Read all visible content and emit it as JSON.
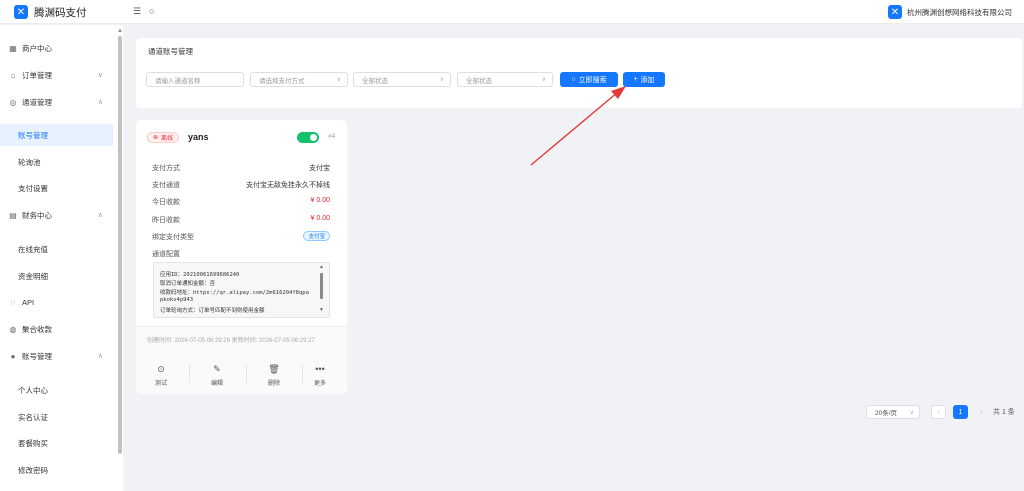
{
  "header": {
    "app_name": "腾渊码支付",
    "company_name": "杭州腾渊创想网络科技有限公司"
  },
  "sidebar": {
    "items": [
      {
        "label": "商户中心",
        "icon": "grid-icon"
      },
      {
        "label": "订单管理",
        "icon": "bag-icon",
        "chevron": "∨"
      },
      {
        "label": "通道管理",
        "icon": "channel-icon",
        "chevron": "∧"
      },
      {
        "label": "账号管理",
        "active": true
      },
      {
        "label": "轮询池"
      },
      {
        "label": "支付设置"
      },
      {
        "label": "财务中心",
        "icon": "finance-icon",
        "chevron": "∧"
      },
      {
        "label": "在线充值"
      },
      {
        "label": "资金明细"
      },
      {
        "label": "API",
        "icon": "api-icon"
      },
      {
        "label": "聚合收款",
        "icon": "aggregate-icon"
      },
      {
        "label": "账号管理",
        "icon": "user-icon",
        "chevron": "∧"
      },
      {
        "label": "个人中心"
      },
      {
        "label": "实名认证"
      },
      {
        "label": "套餐购买"
      },
      {
        "label": "修改密码"
      }
    ]
  },
  "filter": {
    "title": "通道账号管理",
    "name_placeholder": "请输入通道名称",
    "pay_method_placeholder": "请选择支付方式",
    "status1": "全部状态",
    "status2": "全部状态",
    "search_label": "立即搜索",
    "add_label": "添加"
  },
  "account_card": {
    "status": "离线",
    "name": "yans",
    "index": "#4",
    "enabled": true,
    "pay_method_label": "支付方式",
    "pay_method_value": "支付宝",
    "channel_label": "支付通道",
    "channel_value": "支付宝无敌免挂永久不掉线",
    "today_label": "今日收款",
    "today_value": "¥ 0.00",
    "yesterday_label": "昨日收款",
    "yesterday_value": "¥ 0.00",
    "bind_type_label": "绑定支付类型",
    "bind_type_value": "支付宝",
    "config_label": "通道配置",
    "config_lines": [
      "应用ID：20210061699686240",
      "取消订单通知金额：否",
      "收款码地址：https://qr.alipay.com/2m616204f8qpa",
      "pkokv4p943",
      "订单轮询方式：订单号匹配不到则使用金额"
    ],
    "times": "创建时间: 2026-07-05 06:29:26 更新时间: 2026-07-05 06:29:27",
    "actions": [
      {
        "label": "测试",
        "icon": "play-circle-icon"
      },
      {
        "label": "编辑",
        "icon": "pen-icon"
      },
      {
        "label": "删除",
        "icon": "trash-icon"
      },
      {
        "label": "更多",
        "icon": "more-icon"
      }
    ]
  },
  "pagination": {
    "page_size": "20条/页",
    "current_page": "1",
    "total": "共 1 条"
  },
  "colors": {
    "primary": "#1677ff",
    "danger": "#f5222d",
    "success": "#13c26a",
    "annotation_arrow": "#e53935"
  }
}
